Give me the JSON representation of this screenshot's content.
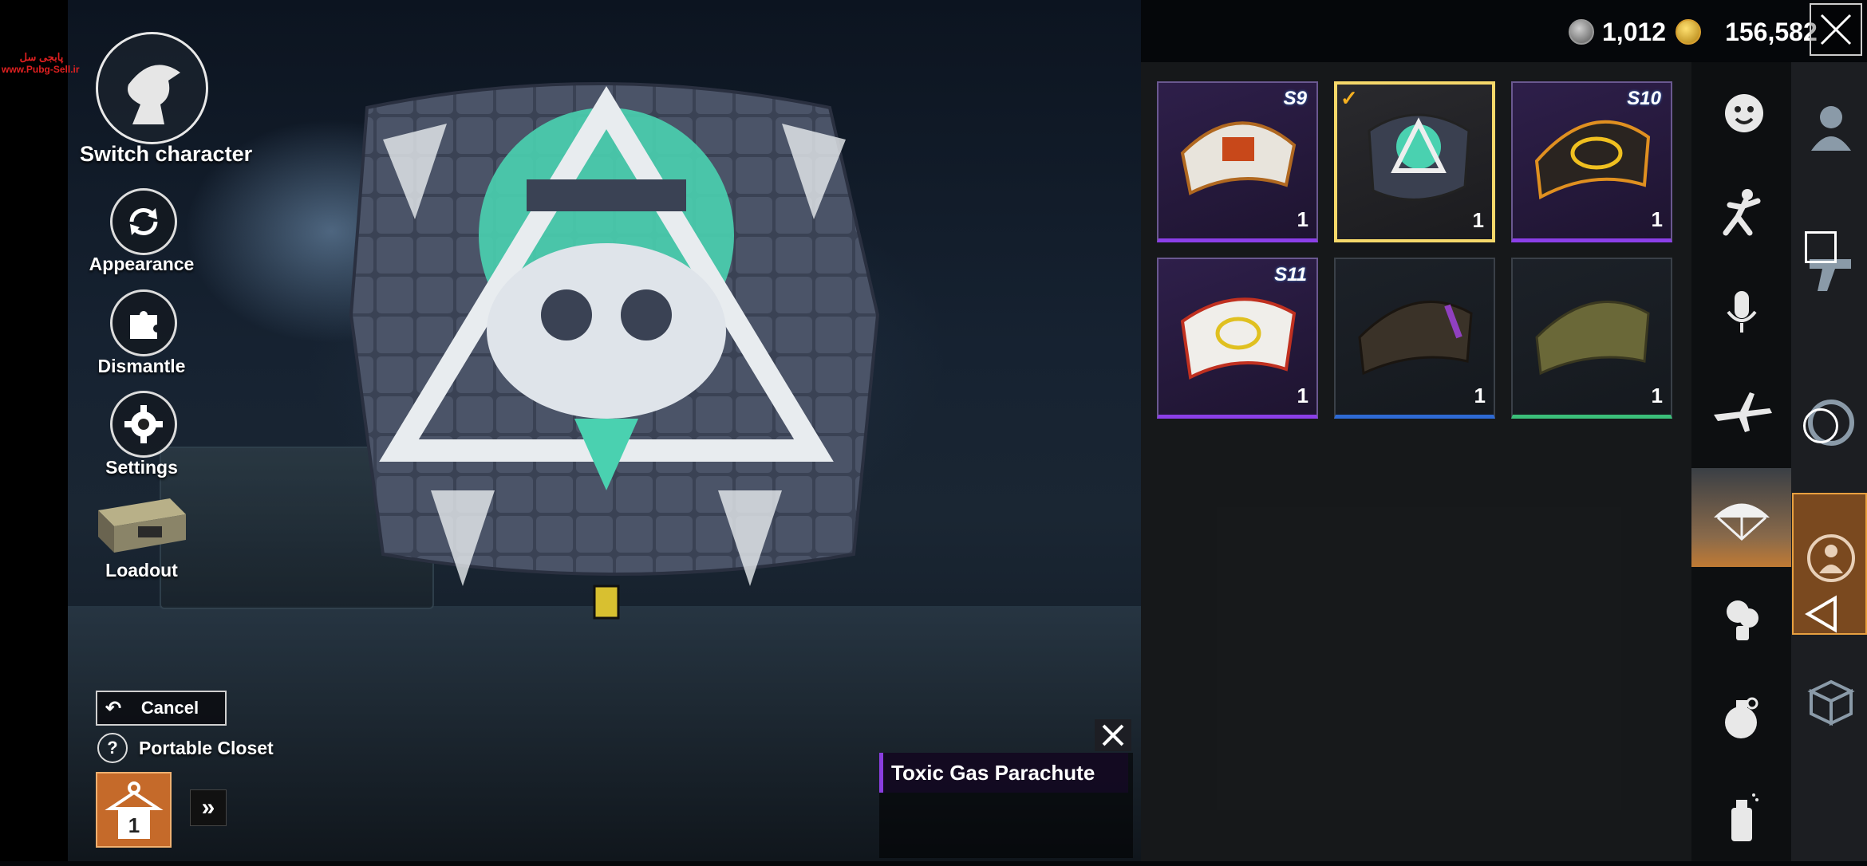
{
  "watermark": {
    "persian": "پابجی سل",
    "url": "www.Pubg-Sell.ir"
  },
  "header": {
    "uc_amount": "1,012",
    "bp_amount": "156,582",
    "close_icon": "close-icon"
  },
  "left_menu": {
    "switch_label": "Switch character",
    "appearance_label": "Appearance",
    "dismantle_label": "Dismantle",
    "settings_label": "Settings",
    "loadout_label": "Loadout"
  },
  "closet": {
    "cancel_label": "Cancel",
    "help_glyph": "?",
    "portable_label": "Portable Closet",
    "slot_count": "1",
    "expand_glyph": "»"
  },
  "detail": {
    "title": "Toxic Gas Parachute"
  },
  "items": [
    {
      "season": "S9",
      "count": "1",
      "rarity": "purple"
    },
    {
      "season": "",
      "count": "1",
      "rarity": "selected",
      "equipped": true
    },
    {
      "season": "S10",
      "count": "1",
      "rarity": "purple"
    },
    {
      "season": "S11",
      "count": "1",
      "rarity": "purple"
    },
    {
      "season": "",
      "count": "1",
      "rarity": "blue"
    },
    {
      "season": "",
      "count": "1",
      "rarity": "green"
    }
  ],
  "categories": [
    "emote-icon",
    "pose-icon",
    "voice-icon",
    "plane-icon",
    "parachute-icon",
    "smoke-icon",
    "grenade-icon",
    "spray-icon"
  ],
  "side_nav": [
    "character-icon",
    "weapon-icon",
    "vehicle-icon",
    "outfit-icon",
    "crate-icon"
  ],
  "colors": {
    "accent_orange": "#c56a2a",
    "rare_purple": "#8b3fe8",
    "selected_gold": "#f5d86a",
    "teal": "#4ad1b0"
  }
}
